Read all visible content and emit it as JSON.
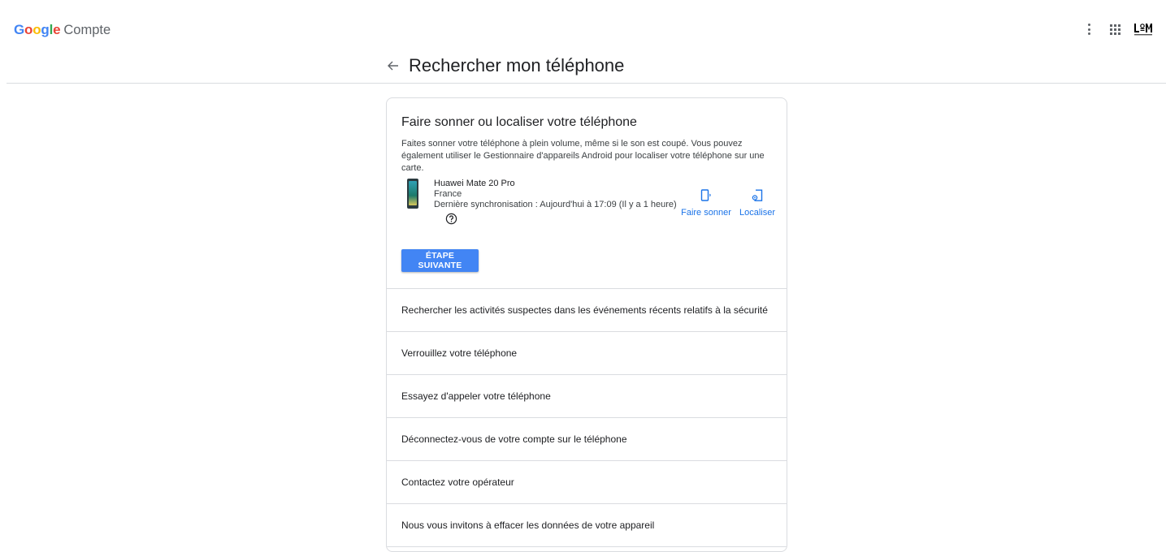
{
  "header": {
    "logo_word": "Google",
    "logo_letters": [
      "G",
      "o",
      "o",
      "g",
      "l",
      "e"
    ],
    "logo_colors": [
      "#4285f4",
      "#ea4335",
      "#fbbc05",
      "#4285f4",
      "#34a853",
      "#ea4335"
    ],
    "product": "Compte",
    "icons": [
      "more-vert-icon",
      "apps-grid-icon",
      "account-avatar"
    ],
    "avatar_text": "L M"
  },
  "page": {
    "title": "Rechercher mon téléphone",
    "back_icon": "arrow-back-icon"
  },
  "ring_section": {
    "title": "Faire sonner ou localiser votre téléphone",
    "description": "Faites sonner votre téléphone à plein volume, même si le son est coupé. Vous pouvez également utiliser le Gestionnaire d'appareils Android pour localiser votre téléphone sur une carte.",
    "device": {
      "name": "Huawei Mate 20 Pro",
      "country": "France",
      "last_sync": "Dernière synchronisation : Aujourd'hui à 17:09 (Il y a 1 heure)"
    },
    "actions": [
      {
        "label": "Faire sonner",
        "icon": "ring-phone-icon"
      },
      {
        "label": "Localiser",
        "icon": "locate-phone-icon"
      }
    ],
    "next_button": "ÉTAPE SUIVANTE"
  },
  "steps": [
    "Rechercher les activités suspectes dans les événements récents relatifs à la sécurité",
    "Verrouillez votre téléphone",
    "Essayez d'appeler votre téléphone",
    "Déconnectez-vous de votre compte sur le téléphone",
    "Contactez votre opérateur",
    "Nous vous invitons à effacer les données de votre appareil"
  ],
  "colors": {
    "accent": "#1a73e8",
    "button": "#4285f4",
    "divider": "#dadce0"
  }
}
